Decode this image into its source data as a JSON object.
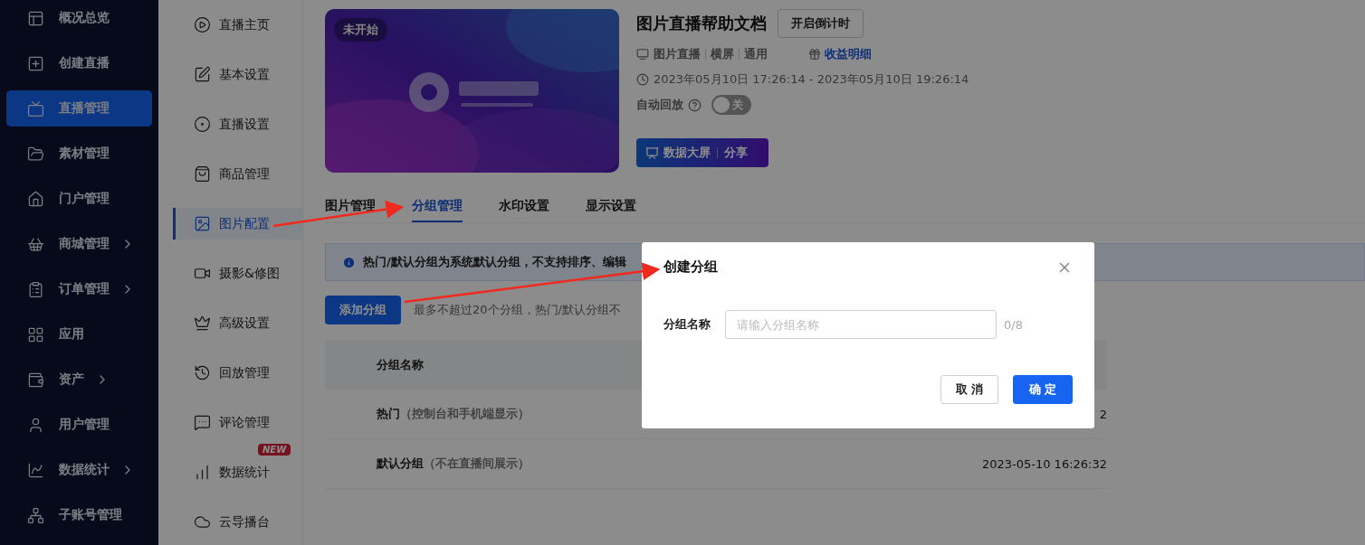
{
  "sidebar": {
    "items": [
      {
        "label": "概况总览",
        "expandable": false,
        "selected": false
      },
      {
        "label": "创建直播",
        "expandable": false,
        "selected": false
      },
      {
        "label": "直播管理",
        "expandable": false,
        "selected": true
      },
      {
        "label": "素材管理",
        "expandable": false,
        "selected": false
      },
      {
        "label": "门户管理",
        "expandable": false,
        "selected": false
      },
      {
        "label": "商城管理",
        "expandable": true,
        "selected": false
      },
      {
        "label": "订单管理",
        "expandable": true,
        "selected": false
      },
      {
        "label": "应用",
        "expandable": false,
        "selected": false
      },
      {
        "label": "资产",
        "expandable": true,
        "selected": false
      },
      {
        "label": "用户管理",
        "expandable": false,
        "selected": false
      },
      {
        "label": "数据统计",
        "expandable": true,
        "selected": false
      },
      {
        "label": "子账号管理",
        "expandable": false,
        "selected": false
      }
    ]
  },
  "submenu": {
    "items": [
      {
        "label": "直播主页",
        "selected": false
      },
      {
        "label": "基本设置",
        "selected": false
      },
      {
        "label": "直播设置",
        "selected": false
      },
      {
        "label": "商品管理",
        "selected": false
      },
      {
        "label": "图片配置",
        "selected": true
      },
      {
        "label": "摄影&修图",
        "selected": false
      },
      {
        "label": "高级设置",
        "selected": false
      },
      {
        "label": "回放管理",
        "selected": false
      },
      {
        "label": "评论管理",
        "selected": false
      },
      {
        "label": "数据统计",
        "selected": false,
        "badge": "NEW"
      },
      {
        "label": "云导播台",
        "selected": false
      }
    ]
  },
  "live": {
    "cover": {
      "kind": "picture",
      "status": "未开始"
    },
    "title": "图片直播帮助文档",
    "countdown_button": "开启倒计时",
    "tags": [
      "图片直播",
      "横屏",
      "通用"
    ],
    "revenue_link": "收益明细",
    "time": "2023年05月10日 17:26:14 - 2023年05月10日 19:26:14",
    "auto_replay": {
      "label": "自动回放",
      "on": false,
      "toggle_text": "关"
    },
    "actions": [
      "数据大屏",
      "分享"
    ]
  },
  "tabs": [
    {
      "label": "图片管理",
      "selected": false
    },
    {
      "label": "分组管理",
      "selected": true
    },
    {
      "label": "水印设置",
      "selected": false
    },
    {
      "label": "显示设置",
      "selected": false
    }
  ],
  "notice": "热门/默认分组为系统默认分组，不支持排序、编辑",
  "add_button": "添加分组",
  "hint": "最多不超过20个分组，热门/默认分组不",
  "table": {
    "columns": [
      "分组名称"
    ],
    "rows": [
      {
        "name": "热门",
        "note": "（控制台和手机端显示）",
        "time": "2"
      },
      {
        "name": "默认分组",
        "note": "（不在直播间展示）",
        "time": "2023-05-10 16:26:32"
      }
    ]
  },
  "dialog": {
    "title": "创建分组",
    "field_label": "分组名称",
    "placeholder": "请输入分组名称",
    "counter": "0/8",
    "buttons": [
      {
        "label": "取 消",
        "kind": "secondary"
      },
      {
        "label": "确 定",
        "kind": "primary"
      }
    ]
  }
}
